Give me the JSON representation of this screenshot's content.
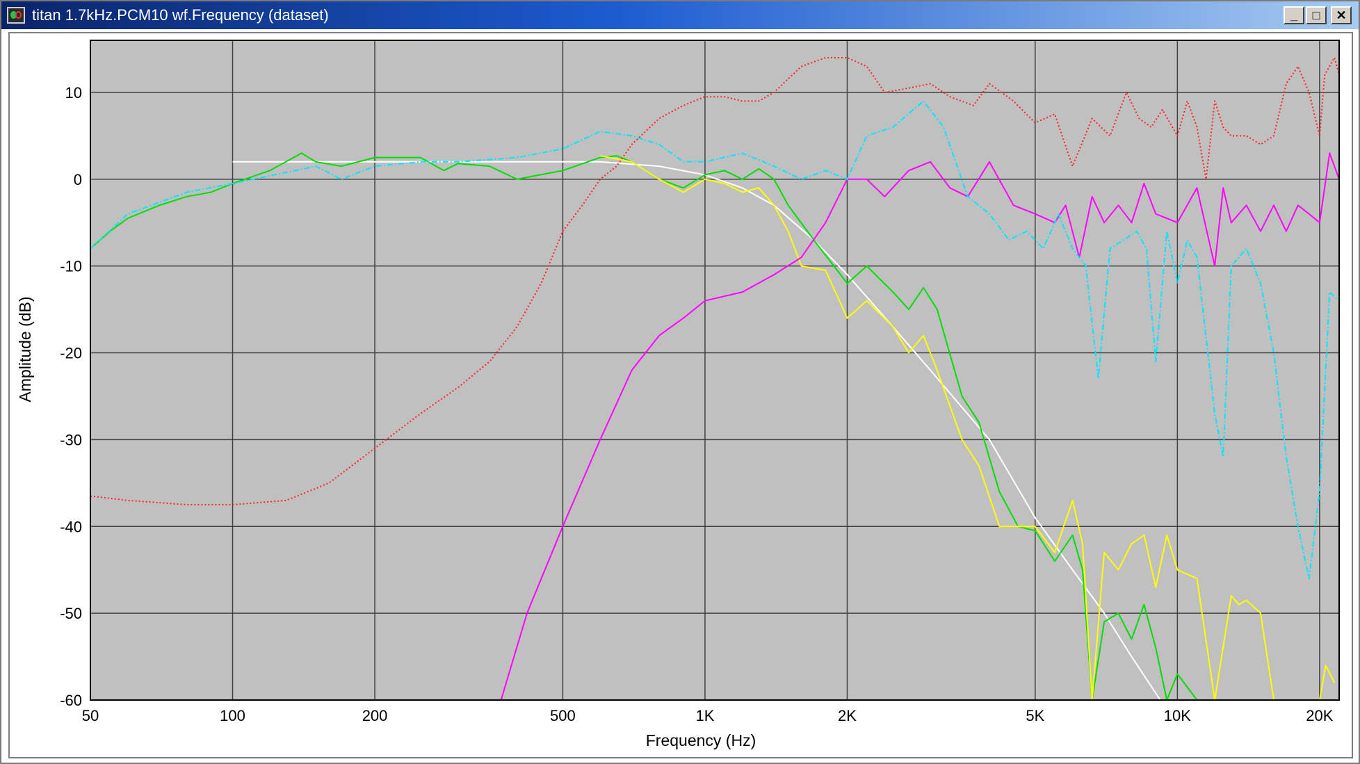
{
  "window": {
    "title": "titan 1.7kHz.PCM10 wf.Frequency (dataset)",
    "minimize_label": "_",
    "maximize_label": "□",
    "close_label": "✕",
    "icon": "app-window-icon"
  },
  "chart_data": {
    "type": "line",
    "xlabel": "Frequency (Hz)",
    "ylabel": "Amplitude (dB)",
    "xscale": "log",
    "xlim": [
      50,
      22000
    ],
    "ylim": [
      -60,
      16
    ],
    "grid": true,
    "background": "#c0c0c0",
    "grid_color": "#404040",
    "x_ticks": [
      {
        "value": 50,
        "label": "50"
      },
      {
        "value": 100,
        "label": "100"
      },
      {
        "value": 200,
        "label": "200"
      },
      {
        "value": 500,
        "label": "500"
      },
      {
        "value": 1000,
        "label": "1K"
      },
      {
        "value": 2000,
        "label": "2K"
      },
      {
        "value": 5000,
        "label": "5K"
      },
      {
        "value": 10000,
        "label": "10K"
      },
      {
        "value": 20000,
        "label": "20K"
      }
    ],
    "y_ticks": [
      {
        "value": 10,
        "label": "10"
      },
      {
        "value": 0,
        "label": "0"
      },
      {
        "value": -10,
        "label": "-10"
      },
      {
        "value": -20,
        "label": "-20"
      },
      {
        "value": -30,
        "label": "-30"
      },
      {
        "value": -40,
        "label": "-40"
      },
      {
        "value": -50,
        "label": "-50"
      },
      {
        "value": -60,
        "label": "-60"
      }
    ],
    "series": [
      {
        "color": "#ffffff",
        "dash": "",
        "points": [
          [
            100,
            2
          ],
          [
            300,
            2
          ],
          [
            600,
            2
          ],
          [
            800,
            1.5
          ],
          [
            1000,
            0.5
          ],
          [
            1200,
            -1
          ],
          [
            1400,
            -3
          ],
          [
            1700,
            -7
          ],
          [
            2000,
            -11
          ],
          [
            2500,
            -17
          ],
          [
            3000,
            -22
          ],
          [
            4000,
            -30
          ],
          [
            5000,
            -39
          ],
          [
            6000,
            -45
          ],
          [
            7000,
            -50
          ],
          [
            8000,
            -55
          ],
          [
            9200,
            -60
          ]
        ]
      },
      {
        "color": "#00dd00",
        "dash": "",
        "points": [
          [
            50,
            -8
          ],
          [
            55,
            -6
          ],
          [
            60,
            -4.5
          ],
          [
            70,
            -3
          ],
          [
            80,
            -2
          ],
          [
            90,
            -1.5
          ],
          [
            100,
            -0.5
          ],
          [
            120,
            1
          ],
          [
            140,
            3
          ],
          [
            150,
            2
          ],
          [
            170,
            1.5
          ],
          [
            200,
            2.5
          ],
          [
            250,
            2.5
          ],
          [
            280,
            1
          ],
          [
            300,
            1.8
          ],
          [
            350,
            1.5
          ],
          [
            400,
            0
          ],
          [
            500,
            1
          ],
          [
            600,
            2.5
          ],
          [
            650,
            2.7
          ],
          [
            700,
            2
          ],
          [
            800,
            0
          ],
          [
            900,
            -1
          ],
          [
            1000,
            0.5
          ],
          [
            1100,
            1
          ],
          [
            1200,
            0
          ],
          [
            1300,
            1.2
          ],
          [
            1400,
            0
          ],
          [
            1500,
            -3
          ],
          [
            1700,
            -7
          ],
          [
            2000,
            -12
          ],
          [
            2200,
            -10
          ],
          [
            2500,
            -13
          ],
          [
            2700,
            -15
          ],
          [
            2900,
            -12.5
          ],
          [
            3100,
            -15
          ],
          [
            3500,
            -25
          ],
          [
            3800,
            -28
          ],
          [
            4200,
            -36
          ],
          [
            4600,
            -40
          ],
          [
            5000,
            -40.5
          ],
          [
            5500,
            -44
          ],
          [
            6000,
            -41
          ],
          [
            6300,
            -45
          ],
          [
            6600,
            -60
          ],
          [
            7000,
            -51
          ],
          [
            7500,
            -50
          ],
          [
            8000,
            -53
          ],
          [
            8500,
            -49
          ],
          [
            9000,
            -54
          ],
          [
            9500,
            -60
          ],
          [
            10000,
            -57
          ],
          [
            11000,
            -60
          ]
        ]
      },
      {
        "color": "#ffff00",
        "dash": "",
        "points": [
          [
            600,
            2.7
          ],
          [
            700,
            2
          ],
          [
            800,
            0
          ],
          [
            900,
            -1.5
          ],
          [
            1000,
            0
          ],
          [
            1100,
            -0.5
          ],
          [
            1200,
            -1.5
          ],
          [
            1300,
            -1
          ],
          [
            1400,
            -3
          ],
          [
            1500,
            -6
          ],
          [
            1600,
            -10
          ],
          [
            1800,
            -10.5
          ],
          [
            2000,
            -16
          ],
          [
            2200,
            -14
          ],
          [
            2500,
            -17
          ],
          [
            2700,
            -20
          ],
          [
            2900,
            -18
          ],
          [
            3100,
            -22
          ],
          [
            3500,
            -30
          ],
          [
            3800,
            -33
          ],
          [
            4200,
            -40
          ],
          [
            4600,
            -40
          ],
          [
            5000,
            -40
          ],
          [
            5500,
            -43
          ],
          [
            6000,
            -37
          ],
          [
            6300,
            -42
          ],
          [
            6600,
            -60
          ],
          [
            7000,
            -43
          ],
          [
            7500,
            -45
          ],
          [
            8000,
            -42
          ],
          [
            8500,
            -41
          ],
          [
            9000,
            -47
          ],
          [
            9500,
            -41
          ],
          [
            10000,
            -45
          ],
          [
            11000,
            -46
          ],
          [
            12000,
            -60
          ],
          [
            13000,
            -48
          ],
          [
            13500,
            -49
          ],
          [
            14000,
            -48.5
          ],
          [
            15000,
            -50
          ],
          [
            16000,
            -60
          ],
          [
            20000,
            -60
          ],
          [
            20600,
            -56
          ],
          [
            21500,
            -58
          ]
        ]
      },
      {
        "color": "#ff00ff",
        "dash": "",
        "points": [
          [
            370,
            -60
          ],
          [
            420,
            -50
          ],
          [
            500,
            -40
          ],
          [
            600,
            -30
          ],
          [
            700,
            -22
          ],
          [
            800,
            -18
          ],
          [
            900,
            -16
          ],
          [
            1000,
            -14
          ],
          [
            1200,
            -13
          ],
          [
            1400,
            -11
          ],
          [
            1600,
            -9
          ],
          [
            1800,
            -5
          ],
          [
            2000,
            0
          ],
          [
            2200,
            0
          ],
          [
            2400,
            -2
          ],
          [
            2700,
            1
          ],
          [
            3000,
            2
          ],
          [
            3300,
            -1
          ],
          [
            3600,
            -2
          ],
          [
            4000,
            2
          ],
          [
            4500,
            -3
          ],
          [
            5000,
            -4
          ],
          [
            5500,
            -5
          ],
          [
            5800,
            -3
          ],
          [
            6200,
            -9
          ],
          [
            6600,
            -2
          ],
          [
            7000,
            -5
          ],
          [
            7500,
            -3
          ],
          [
            8000,
            -5
          ],
          [
            8500,
            -0.5
          ],
          [
            9000,
            -4
          ],
          [
            10000,
            -5
          ],
          [
            11000,
            -1
          ],
          [
            12000,
            -10
          ],
          [
            12500,
            -1
          ],
          [
            13000,
            -5
          ],
          [
            14000,
            -3
          ],
          [
            15000,
            -6
          ],
          [
            16000,
            -3
          ],
          [
            17000,
            -6
          ],
          [
            18000,
            -3
          ],
          [
            19000,
            -4
          ],
          [
            20000,
            -5
          ],
          [
            21000,
            3
          ],
          [
            22000,
            0
          ]
        ]
      },
      {
        "color": "#00e6ff",
        "dash": "8,3,2,3",
        "points": [
          [
            50,
            -8
          ],
          [
            60,
            -4
          ],
          [
            80,
            -1.5
          ],
          [
            100,
            -0.5
          ],
          [
            150,
            1.5
          ],
          [
            170,
            0
          ],
          [
            200,
            1.5
          ],
          [
            250,
            2
          ],
          [
            300,
            2
          ],
          [
            400,
            2.5
          ],
          [
            500,
            3.5
          ],
          [
            600,
            5.5
          ],
          [
            700,
            5
          ],
          [
            800,
            4
          ],
          [
            900,
            2
          ],
          [
            1000,
            2
          ],
          [
            1200,
            3
          ],
          [
            1400,
            1.5
          ],
          [
            1600,
            0
          ],
          [
            1800,
            1
          ],
          [
            2000,
            0
          ],
          [
            2200,
            5
          ],
          [
            2500,
            6
          ],
          [
            2900,
            9
          ],
          [
            3200,
            6
          ],
          [
            3600,
            -2
          ],
          [
            4000,
            -4
          ],
          [
            4400,
            -7
          ],
          [
            4800,
            -6
          ],
          [
            5200,
            -8
          ],
          [
            5600,
            -4
          ],
          [
            6000,
            -8
          ],
          [
            6400,
            -10
          ],
          [
            6800,
            -23
          ],
          [
            7200,
            -8
          ],
          [
            7700,
            -7
          ],
          [
            8200,
            -6
          ],
          [
            8600,
            -8
          ],
          [
            9000,
            -21
          ],
          [
            9500,
            -6
          ],
          [
            10000,
            -12
          ],
          [
            10500,
            -7
          ],
          [
            11000,
            -9
          ],
          [
            12000,
            -27
          ],
          [
            12500,
            -32
          ],
          [
            13000,
            -10
          ],
          [
            14000,
            -8
          ],
          [
            15000,
            -12
          ],
          [
            16000,
            -20
          ],
          [
            17000,
            -32
          ],
          [
            18000,
            -40
          ],
          [
            19000,
            -46
          ],
          [
            20000,
            -36
          ],
          [
            21000,
            -13
          ],
          [
            22000,
            -14
          ]
        ]
      },
      {
        "color": "#ff2222",
        "dash": "2,3",
        "points": [
          [
            50,
            -36.5
          ],
          [
            60,
            -37
          ],
          [
            80,
            -37.5
          ],
          [
            100,
            -37.5
          ],
          [
            130,
            -37
          ],
          [
            160,
            -35
          ],
          [
            200,
            -31
          ],
          [
            250,
            -27
          ],
          [
            300,
            -24
          ],
          [
            350,
            -21
          ],
          [
            400,
            -17
          ],
          [
            450,
            -12
          ],
          [
            500,
            -6
          ],
          [
            550,
            -3
          ],
          [
            600,
            0
          ],
          [
            650,
            1.5
          ],
          [
            700,
            4
          ],
          [
            800,
            7
          ],
          [
            900,
            8.5
          ],
          [
            1000,
            9.5
          ],
          [
            1100,
            9.5
          ],
          [
            1200,
            9
          ],
          [
            1300,
            9
          ],
          [
            1400,
            10
          ],
          [
            1600,
            13
          ],
          [
            1800,
            14
          ],
          [
            2000,
            14
          ],
          [
            2200,
            13
          ],
          [
            2400,
            10
          ],
          [
            2700,
            10.5
          ],
          [
            3000,
            11
          ],
          [
            3300,
            9.5
          ],
          [
            3700,
            8.5
          ],
          [
            4000,
            11
          ],
          [
            4500,
            9
          ],
          [
            5000,
            6.5
          ],
          [
            5500,
            7.5
          ],
          [
            6000,
            1.5
          ],
          [
            6600,
            7
          ],
          [
            7200,
            5
          ],
          [
            7800,
            10
          ],
          [
            8300,
            7
          ],
          [
            8800,
            6
          ],
          [
            9300,
            8
          ],
          [
            10000,
            5
          ],
          [
            10500,
            9
          ],
          [
            11000,
            6
          ],
          [
            11500,
            0
          ],
          [
            12000,
            9
          ],
          [
            12500,
            6
          ],
          [
            13000,
            5
          ],
          [
            14000,
            5
          ],
          [
            15000,
            4
          ],
          [
            16000,
            5
          ],
          [
            17000,
            11
          ],
          [
            18000,
            13
          ],
          [
            19000,
            10
          ],
          [
            20000,
            5
          ],
          [
            20500,
            12
          ],
          [
            21500,
            14
          ],
          [
            22000,
            12
          ]
        ]
      }
    ]
  }
}
